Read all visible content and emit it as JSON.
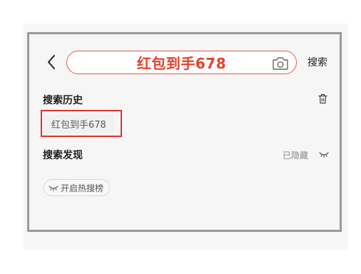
{
  "header": {
    "search_value": "红包到手678",
    "search_button": "搜索"
  },
  "history": {
    "title": "搜索历史",
    "items": [
      {
        "label": "红包到手678"
      }
    ]
  },
  "discover": {
    "title": "搜索发现",
    "hidden_label": "已隐藏",
    "open_hot_label": "开启热搜榜"
  },
  "colors": {
    "accent": "#e8412b",
    "highlight_box": "#e0322b"
  },
  "icons": {
    "back": "chevron-left-icon",
    "camera": "camera-icon",
    "trash": "trash-icon",
    "eye_closed": "eye-closed-icon"
  }
}
